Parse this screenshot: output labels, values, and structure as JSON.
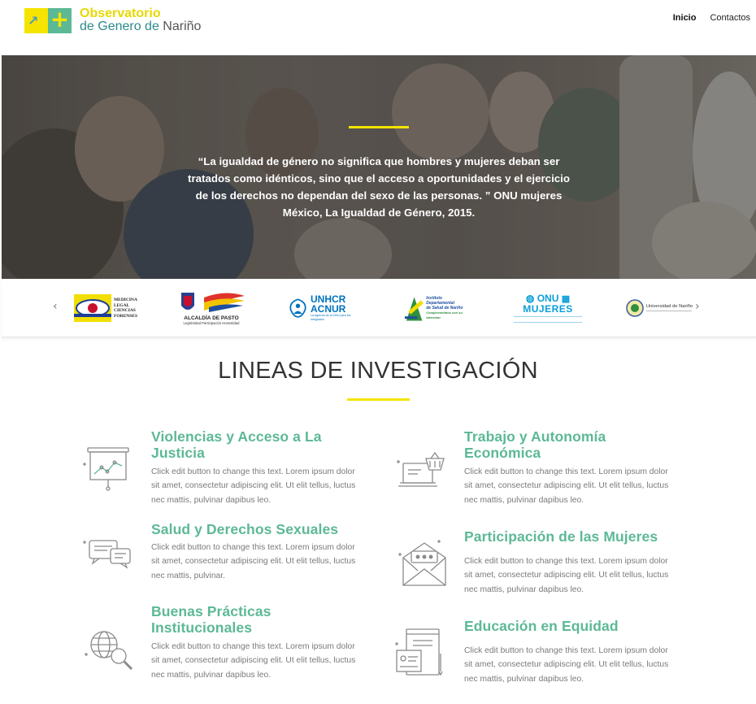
{
  "header": {
    "logo_line1": "Observatorio",
    "logo_line2a": "de Genero de ",
    "logo_line2b": "Nariño",
    "nav": [
      {
        "label": "Inicio",
        "active": true
      },
      {
        "label": "Contactos",
        "active": false
      }
    ]
  },
  "hero": {
    "quote": "“La igualdad de género no significa que hombres y mujeres deban ser tratados como idénticos, sino que el acceso a oportunidades y el ejercicio de los derechos no dependan del sexo de las personas. ” ONU mujeres México, La Igualdad de Género, 2015."
  },
  "partners": {
    "logos": [
      {
        "name": "medicina-legal",
        "text1": "MEDICINA",
        "text2": "LEGAL",
        "text3": "CIENCIAS",
        "text4": "FORENSES"
      },
      {
        "name": "alcaldia-pasto",
        "text1": "ALCALDÍA DE PASTO",
        "text2": "Legitimidad Participación Honestidad"
      },
      {
        "name": "unhcr-acnur",
        "text1": "UNHCR",
        "text2": "ACNUR",
        "text3": "La Agencia de la ONU para los refugiados"
      },
      {
        "name": "instituto-salud",
        "text1": "Instituto",
        "text2": "Departamental",
        "text3": "de Salud de Nariño",
        "text4": "Comprometidos con su bienestar"
      },
      {
        "name": "onu-mujeres",
        "text1": "ONU",
        "text2": "MUJERES"
      },
      {
        "name": "universidad-narino",
        "text1": "Universidad de Nariño"
      }
    ],
    "prev_icon": "chevron-left-icon",
    "next_icon": "chevron-right-icon"
  },
  "section": {
    "title": "LINEAS DE INVESTIGACIÓN"
  },
  "lines": [
    {
      "title": "Violencias y Acceso a La Justicia",
      "text": "Click edit button to change this text. Lorem ipsum dolor sit amet, consectetur adipiscing elit. Ut elit tellus, luctus nec mattis, pulvinar dapibus leo.",
      "icon": "presentation-board-icon"
    },
    {
      "title": "Trabajo y Autonomía Económica",
      "text": "Click edit button to change this text. Lorem ipsum dolor sit amet, consectetur adipiscing elit. Ut elit tellus, luctus nec mattis, pulvinar dapibus leo.",
      "icon": "laptop-basket-icon"
    },
    {
      "title": "Salud y Derechos Sexuales",
      "text": "Click edit button to change this text. Lorem ipsum dolor sit amet, consectetur adipiscing elit. Ut elit tellus, luctus nec mattis, pulvinar.",
      "icon": "chat-bubbles-icon"
    },
    {
      "title": "Participación de las Mujeres",
      "text": "Click edit button to change this text. Lorem ipsum dolor sit amet, consectetur adipiscing elit. Ut elit tellus, luctus nec mattis, pulvinar dapibus leo.",
      "icon": "envelope-icon"
    },
    {
      "title": "Buenas Prácticas Institucionales",
      "text": "Click edit button to change this text. Lorem ipsum dolor sit amet, consectetur adipiscing elit. Ut elit tellus, luctus nec mattis, pulvinar dapibus leo.",
      "icon": "globe-search-icon"
    },
    {
      "title": "Educación en Equidad",
      "text": "Click edit button to change this text. Lorem ipsum dolor sit amet, consectetur adipiscing elit. Ut elit tellus, luctus nec mattis, pulvinar dapibus leo.",
      "icon": "document-form-icon"
    }
  ],
  "colors": {
    "accent_yellow": "#f5e400",
    "accent_green": "#5cb995"
  }
}
